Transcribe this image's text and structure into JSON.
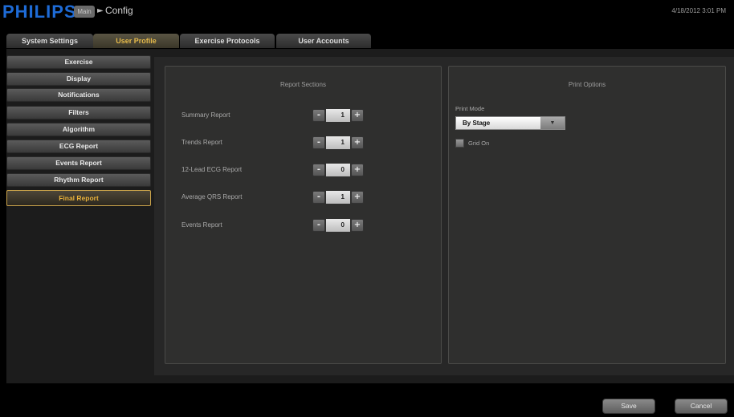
{
  "app": {
    "brand": "PHILIPS",
    "mode_badge": "Main",
    "breadcrumb": "Config",
    "datetime": "4/18/2012 3:01 PM"
  },
  "tabs": [
    {
      "label": "System Settings",
      "active": false
    },
    {
      "label": "User Profile",
      "active": true
    },
    {
      "label": "Exercise Protocols",
      "active": false
    },
    {
      "label": "User Accounts",
      "active": false
    }
  ],
  "sidebar": {
    "items": [
      {
        "label": "Exercise"
      },
      {
        "label": "Display"
      },
      {
        "label": "Notifications"
      },
      {
        "label": "Filters"
      },
      {
        "label": "Algorithm"
      },
      {
        "label": "ECG Report"
      },
      {
        "label": "Events Report"
      },
      {
        "label": "Rhythm Report"
      },
      {
        "label": "Final Report",
        "active": true
      }
    ]
  },
  "report_sections": {
    "title": "Report Sections",
    "rows": [
      {
        "label": "Summary Report",
        "value": "1"
      },
      {
        "label": "Trends Report",
        "value": "1"
      },
      {
        "label": "12-Lead ECG Report",
        "value": "0"
      },
      {
        "label": "Average QRS Report",
        "value": "1"
      },
      {
        "label": "Events Report",
        "value": "0"
      }
    ],
    "minus_symbol": "-",
    "plus_symbol": "+"
  },
  "print_options": {
    "title": "Print Options",
    "print_mode_label": "Print Mode",
    "print_mode_value": "By Stage",
    "dropdown_arrow": "▼",
    "grid_on_label": "Grid On",
    "grid_on_checked": false
  },
  "footer": {
    "save_label": "Save",
    "cancel_label": "Cancel"
  },
  "colors": {
    "brand_blue": "#1e6bd6",
    "active_accent": "#e8b13c"
  }
}
